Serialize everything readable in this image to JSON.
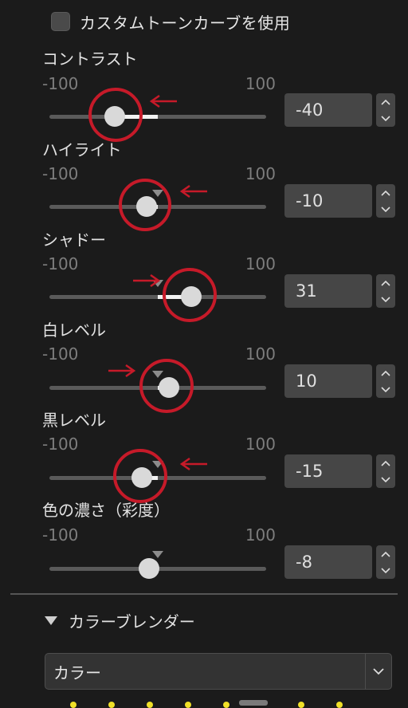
{
  "custom_tone_curve": {
    "label": "カスタムトーンカーブを使用",
    "checked": false
  },
  "sliders": [
    {
      "label": "コントラスト",
      "min": "-100",
      "max": "100",
      "value": "-40",
      "value_num": -40,
      "default": 0
    },
    {
      "label": "ハイライト",
      "min": "-100",
      "max": "100",
      "value": "-10",
      "value_num": -10,
      "default": 0
    },
    {
      "label": "シャドー",
      "min": "-100",
      "max": "100",
      "value": "31",
      "value_num": 31,
      "default": 0
    },
    {
      "label": "白レベル",
      "min": "-100",
      "max": "100",
      "value": "10",
      "value_num": 10,
      "default": 0
    },
    {
      "label": "黒レベル",
      "min": "-100",
      "max": "100",
      "value": "-15",
      "value_num": -15,
      "default": 0
    },
    {
      "label": "色の濃さ（彩度）",
      "min": "-100",
      "max": "100",
      "value": "-8",
      "value_num": -8,
      "default": 0
    }
  ],
  "color_blender": {
    "title": "カラーブレンダー",
    "expanded": true
  },
  "color_dropdown": {
    "selected": "カラー"
  },
  "colors": {
    "annotation": "#c61a29",
    "swatch_dot": "#f0e028"
  }
}
